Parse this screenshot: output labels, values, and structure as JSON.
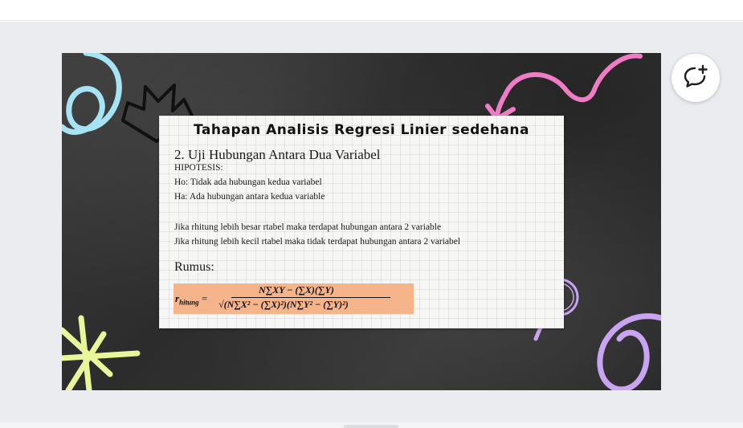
{
  "slide": {
    "heading": "Tahapan Analisis Regresi Linier sedehana",
    "subtitle": "2. Uji Hubungan Antara Dua Variabel",
    "hipotesis_label": "HIPOTESIS:",
    "ho": "Ho: Tidak ada hubungan kedua variabel",
    "ha": "Ha: Ada hubungan antara kedua variable",
    "rule_1": "Jika rhitung lebih besar rtabel maka terdapat hubungan antara 2 variable",
    "rule_2": "Jika rhitung lebih kecil rtabel maka tidak terdapat hubungan antara 2 variabel",
    "rumus_label": "Rumus:",
    "formula": {
      "lhs_symbol": "r",
      "lhs_subscript": "hitung",
      "equals": "=",
      "numerator": "N∑XY − (∑X)(∑Y)",
      "denominator": "√(N∑X² − (∑X)²)(N∑Y² − (∑Y)²)"
    }
  },
  "decorations": {
    "crown_icon": "crown-icon",
    "pink_arrow_icon": "curved-arrow-icon",
    "magnifier_icon": "magnifying-glass-icon",
    "star_icon": "starburst-icon",
    "swirl_icons": [
      "blue-swirl-icon",
      "purple-swirl-icon"
    ]
  },
  "comment_button": {
    "icon": "add-comment-icon"
  },
  "colors": {
    "chalkboard": "#2f2f2f",
    "paper": "#f6f6f4",
    "formula_highlight": "#f5b48a",
    "blue_swirl": "#a6e3f5",
    "pink_arrow": "#f07cc6",
    "purple": "#c9a4f2",
    "yellow_star": "#e9f79a"
  }
}
